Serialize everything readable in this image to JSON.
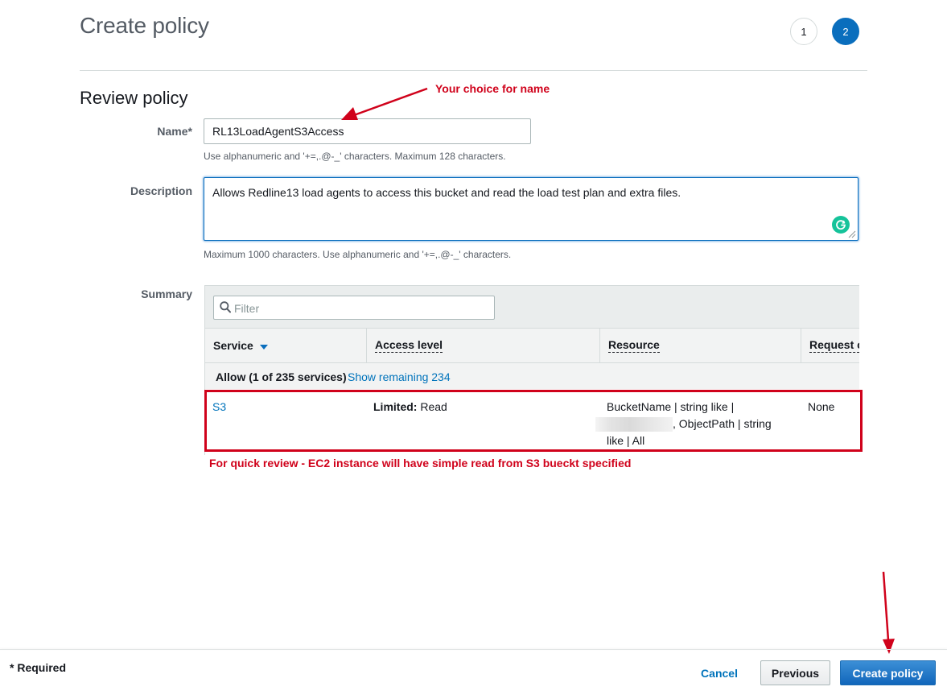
{
  "header": {
    "title": "Create policy",
    "steps": [
      "1",
      "2"
    ],
    "active_step": "2"
  },
  "review": {
    "section_title": "Review policy",
    "name_label": "Name*",
    "name_value": "RL13LoadAgentS3Access",
    "name_hint": "Use alphanumeric and '+=,.@-_' characters. Maximum 128 characters.",
    "description_label": "Description",
    "description_value": "Allows Redline13 load agents to access this bucket and read the load test plan and extra files.",
    "description_hint": "Maximum 1000 characters. Use alphanumeric and '+=,.@-_' characters.",
    "summary_label": "Summary"
  },
  "summary": {
    "filter_placeholder": "Filter",
    "columns": [
      "Service",
      "Access level",
      "Resource",
      "Request c"
    ],
    "allow_text": "Allow (1 of 235 services)",
    "show_remaining": "Show remaining 234",
    "row": {
      "service": "S3",
      "access_bold": "Limited:",
      "access_rest": " Read",
      "resource_line1": "BucketName | string like |",
      "resource_line2": ", ObjectPath | string",
      "resource_line3": "like | All",
      "request": "None"
    }
  },
  "annotations": {
    "name_note": "Your choice for name",
    "review_note": "For quick review -  EC2 instance will have simple read from S3 bueckt specified",
    "color": "#d0021b"
  },
  "footer": {
    "required": "* Required",
    "cancel": "Cancel",
    "previous": "Previous",
    "create": "Create policy"
  },
  "colors": {
    "primary": "#0a6ebd",
    "link": "#0073bb",
    "grammarly": "#15c39a"
  }
}
